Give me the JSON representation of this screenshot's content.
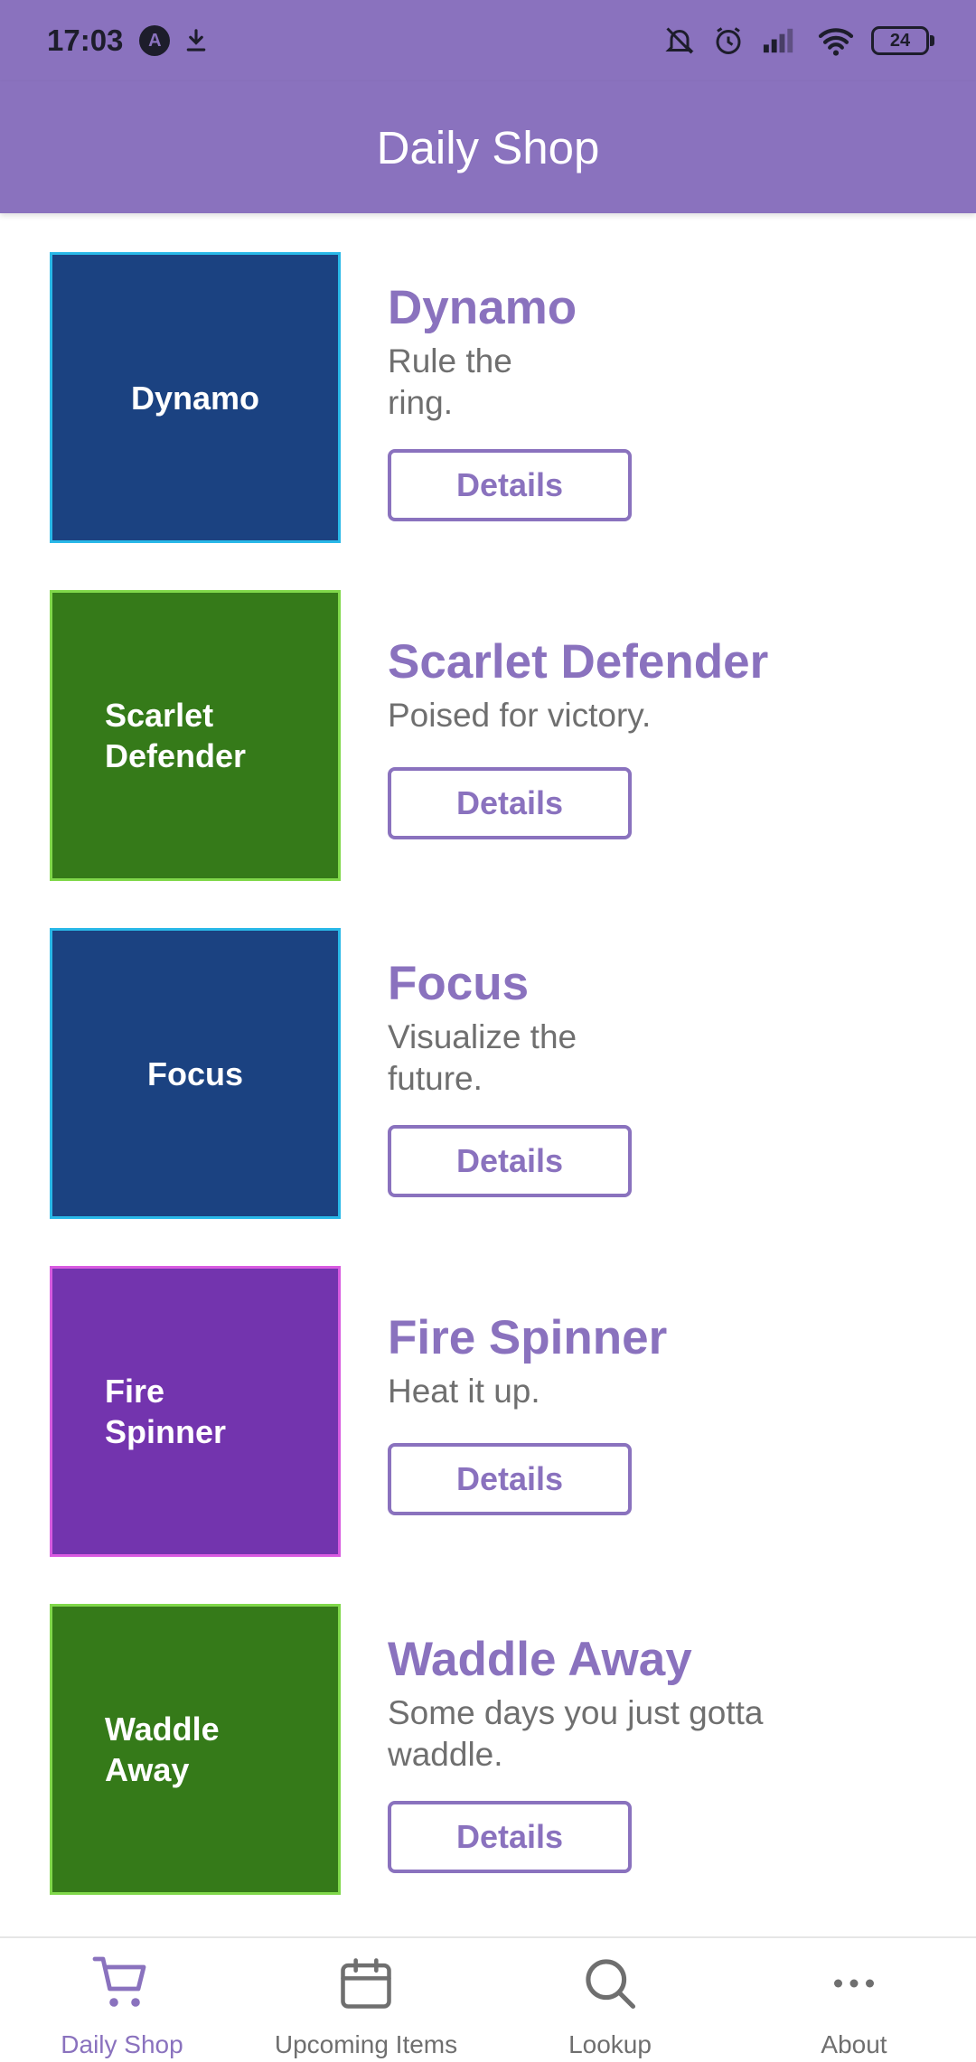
{
  "status": {
    "time": "17:03",
    "battery": "24"
  },
  "appbar": {
    "title": "Daily Shop"
  },
  "items": [
    {
      "thumb_label": "Dynamo",
      "name": "Dynamo",
      "desc": "Rule the ring.",
      "button": "Details"
    },
    {
      "thumb_label": "Scarlet Defender",
      "name": "Scarlet Defender",
      "desc": "Poised for victory.",
      "button": "Details"
    },
    {
      "thumb_label": "Focus",
      "name": "Focus",
      "desc": "Visualize the future.",
      "button": "Details"
    },
    {
      "thumb_label": "Fire Spinner",
      "name": "Fire Spinner",
      "desc": "Heat it up.",
      "button": "Details"
    },
    {
      "thumb_label": "Waddle Away",
      "name": "Waddle Away",
      "desc": "Some days you just gotta waddle.",
      "button": "Details"
    }
  ],
  "colors": {
    "accent": "#8a72be",
    "blue_bg": "#1b4281",
    "blue_border": "#29b8e8",
    "green_bg": "#357a19",
    "green_border": "#80d84a",
    "purple_bg": "#7334ae",
    "purple_border": "#d85ae0"
  },
  "nav": [
    {
      "label": "Daily Shop",
      "icon": "cart-icon",
      "active": true
    },
    {
      "label": "Upcoming Items",
      "icon": "calendar-icon",
      "active": false
    },
    {
      "label": "Lookup",
      "icon": "search-icon",
      "active": false
    },
    {
      "label": "About",
      "icon": "more-icon",
      "active": false
    }
  ]
}
